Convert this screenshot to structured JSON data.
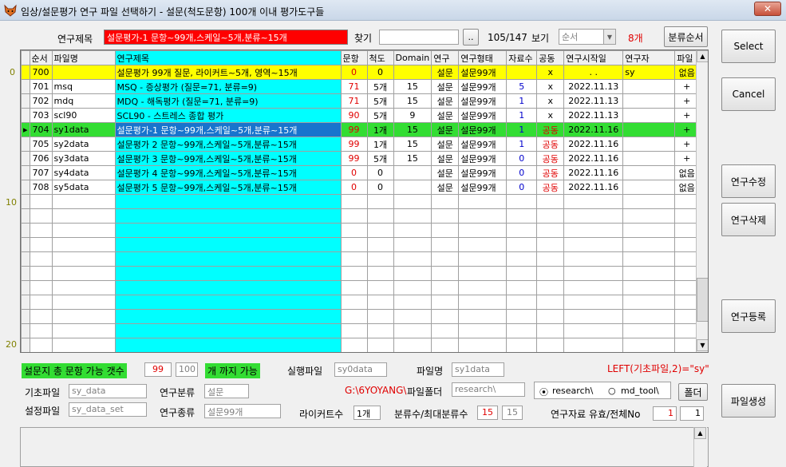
{
  "window": {
    "title": "임상/설문평가 연구 파일 선택하기  - 설문(척도문항) 100개 이내 평가도구들",
    "close_label": "✕"
  },
  "toolbar": {
    "research_title_label": "연구제목",
    "research_title_value": "설문평가-1 문항~99개,스케일~5개,분류~15개",
    "find_label": "찾기",
    "find_value": "",
    "find_button_label": "..",
    "count_text": "105/147",
    "view_label": "보기",
    "view_value": "순서",
    "count_red": "8개",
    "sort_button_label": "분류순서"
  },
  "side_buttons": {
    "select": "Select",
    "cancel": "Cancel",
    "edit": "연구수정",
    "delete": "연구삭제",
    "register": "연구등록",
    "create_file": "파일생성"
  },
  "grid": {
    "headers": [
      "순서",
      "파일명",
      "연구제목",
      "문항",
      "척도",
      "Domain",
      "연구",
      "연구형태",
      "자료수",
      "공동",
      "연구시작일",
      "연구자",
      "파일"
    ],
    "row_markers": [
      "0",
      "10",
      "20"
    ],
    "rows": [
      {
        "no": "700",
        "file": "",
        "title": "설문평가 99개 질문, 라이커트~5개, 영역~15개",
        "items": "0",
        "scale": "0",
        "domain": "",
        "study": "설문",
        "form": "설문99개",
        "data": "",
        "joint": "x",
        "start": ". .",
        "researcher": "sy",
        "filecol": "없음"
      },
      {
        "no": "701",
        "file": "msq",
        "title": "MSQ - 증상평가 (질문=71, 분류=9)",
        "items": "71",
        "scale": "5개",
        "domain": "15",
        "study": "설문",
        "form": "설문99개",
        "data": "5",
        "joint": "x",
        "start": "2022.11.13",
        "researcher": "",
        "filecol": "+"
      },
      {
        "no": "702",
        "file": "mdq",
        "title": "MDQ - 해독평가 (질문=71, 분류=9)",
        "items": "71",
        "scale": "5개",
        "domain": "15",
        "study": "설문",
        "form": "설문99개",
        "data": "1",
        "joint": "x",
        "start": "2022.11.13",
        "researcher": "",
        "filecol": "+"
      },
      {
        "no": "703",
        "file": "scl90",
        "title": "SCL90 - 스트레스 종합 평가",
        "items": "90",
        "scale": "5개",
        "domain": "9",
        "study": "설문",
        "form": "설문99개",
        "data": "1",
        "joint": "x",
        "start": "2022.11.13",
        "researcher": "",
        "filecol": "+"
      },
      {
        "no": "704",
        "file": "sy1data",
        "title": "설문평가-1 문항~99개,스케일~5개,분류~15개",
        "items": "99",
        "scale": "1개",
        "domain": "15",
        "study": "설문",
        "form": "설문99개",
        "data": "1",
        "joint": "공동",
        "start": "2022.11.16",
        "researcher": "",
        "filecol": "+"
      },
      {
        "no": "705",
        "file": "sy2data",
        "title": "설문평가 2  문항~99개,스케일~5개,분류~15개",
        "items": "99",
        "scale": "1개",
        "domain": "15",
        "study": "설문",
        "form": "설문99개",
        "data": "1",
        "joint": "공동",
        "start": "2022.11.16",
        "researcher": "",
        "filecol": "+"
      },
      {
        "no": "706",
        "file": "sy3data",
        "title": "설문평가 3  문항~99개,스케일~5개,분류~15개",
        "items": "99",
        "scale": "5개",
        "domain": "15",
        "study": "설문",
        "form": "설문99개",
        "data": "0",
        "joint": "공동",
        "start": "2022.11.16",
        "researcher": "",
        "filecol": "+"
      },
      {
        "no": "707",
        "file": "sy4data",
        "title": "설문평가 4  문항~99개,스케일~5개,분류~15개",
        "items": "0",
        "scale": "0",
        "domain": "",
        "study": "설문",
        "form": "설문99개",
        "data": "0",
        "joint": "공동",
        "start": "2022.11.16",
        "researcher": "",
        "filecol": "없음"
      },
      {
        "no": "708",
        "file": "sy5data",
        "title": "설문평가 5  문항~99개,스케일~5개,분류~15개",
        "items": "0",
        "scale": "0",
        "domain": "",
        "study": "설문",
        "form": "설문99개",
        "data": "0",
        "joint": "공동",
        "start": "2022.11.16",
        "researcher": "",
        "filecol": "없음"
      }
    ]
  },
  "bottom": {
    "max_items_label": "설문지 총 문항 가능 갯수",
    "max_items_value": "99",
    "max_items_limit": "100",
    "max_items_suffix": "개 까지 가능",
    "run_file_label": "실행파일",
    "run_file_value": "sy0data",
    "file_name_label": "파일명",
    "file_name_value": "sy1data",
    "formula_text": "LEFT(기초파일,2)=\"sy\"",
    "base_file_label": "기초파일",
    "base_file_value": "sy_data",
    "category_label": "연구분류",
    "category_value": "설문",
    "path_text": "G:\\6YOYANG\\",
    "folder_label": "파일폴더",
    "folder_value": "research\\",
    "radio_research": "research\\",
    "radio_mdtool": "md_tool\\",
    "folder_button": "폴더",
    "setting_file_label": "설정파일",
    "setting_file_value": "sy_data_set",
    "kind_label": "연구종류",
    "kind_value": "설문99개",
    "likert_label": "라이커트수",
    "likert_value": "1개",
    "class_label": "분류수/최대분류수",
    "class_value": "15",
    "class_max": "15",
    "valid_label": "연구자료 유효/전체No",
    "valid_value": "1",
    "valid_total": "1"
  }
}
